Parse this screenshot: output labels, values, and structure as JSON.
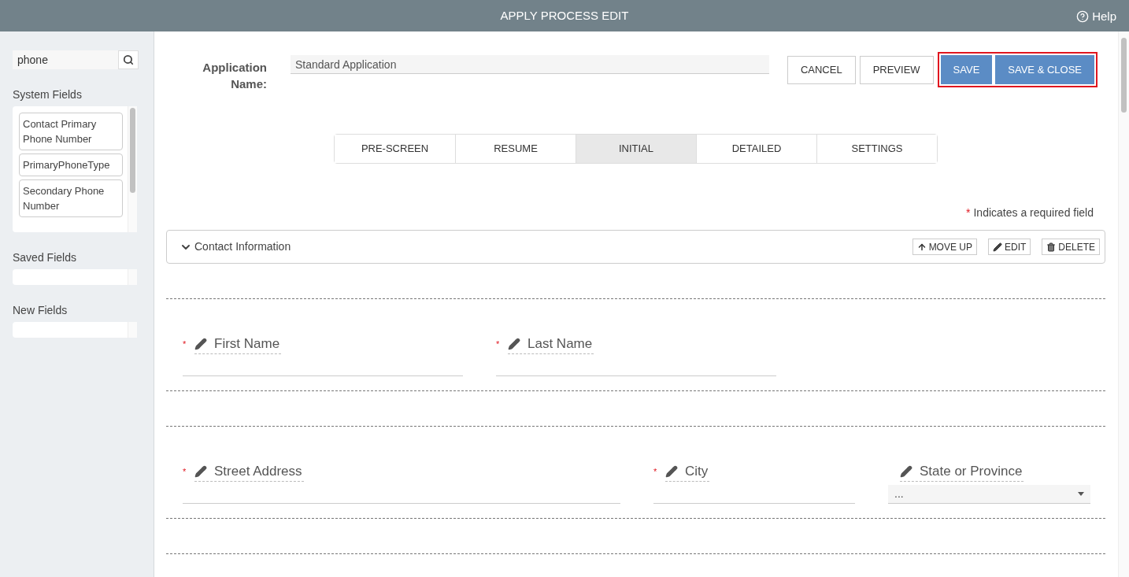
{
  "window": {
    "title": "APPLY PROCESS EDIT",
    "help": "Help"
  },
  "sidebar": {
    "search": {
      "value": "phone"
    },
    "groups": [
      {
        "label": "System Fields",
        "items": [
          "Contact Primary Phone Number",
          "PrimaryPhoneType",
          "Secondary Phone Number"
        ]
      },
      {
        "label": "Saved Fields"
      },
      {
        "label": "New Fields"
      }
    ]
  },
  "application_name": {
    "label": "Application Name:",
    "value": "Standard Application"
  },
  "buttons": [
    {
      "label": "CANCEL",
      "kind": "plain"
    },
    {
      "label": "PREVIEW",
      "kind": "plain"
    },
    {
      "label": "SAVE",
      "kind": "primary"
    },
    {
      "label": "SAVE & CLOSE",
      "kind": "primary"
    }
  ],
  "tabs": [
    {
      "label": "PRE-SCREEN",
      "selected": false
    },
    {
      "label": "RESUME",
      "selected": false
    },
    {
      "label": "INITIAL",
      "selected": true
    },
    {
      "label": "DETAILED",
      "selected": false
    },
    {
      "label": "SETTINGS",
      "selected": false
    }
  ],
  "required_note": {
    "mark": "*",
    "text": "Indicates a required field"
  },
  "section": {
    "title": "Contact Information",
    "expanded": true,
    "actions": [
      {
        "label": "MOVE UP",
        "kind": "move"
      },
      {
        "label": "EDIT",
        "kind": "edit"
      },
      {
        "label": "DELETE",
        "kind": "delete"
      }
    ],
    "rows": [
      {
        "fields": [
          {
            "label": "First Name",
            "required": true,
            "kind": "text"
          },
          {
            "label": "Last Name",
            "required": true,
            "kind": "text"
          }
        ]
      },
      {
        "fields": [
          {
            "label": "Street Address",
            "required": true,
            "kind": "text"
          },
          {
            "label": "City",
            "required": true,
            "kind": "text"
          },
          {
            "label": "State or Province",
            "required": false,
            "kind": "select",
            "value": "..."
          }
        ]
      },
      {
        "fields": []
      }
    ]
  }
}
